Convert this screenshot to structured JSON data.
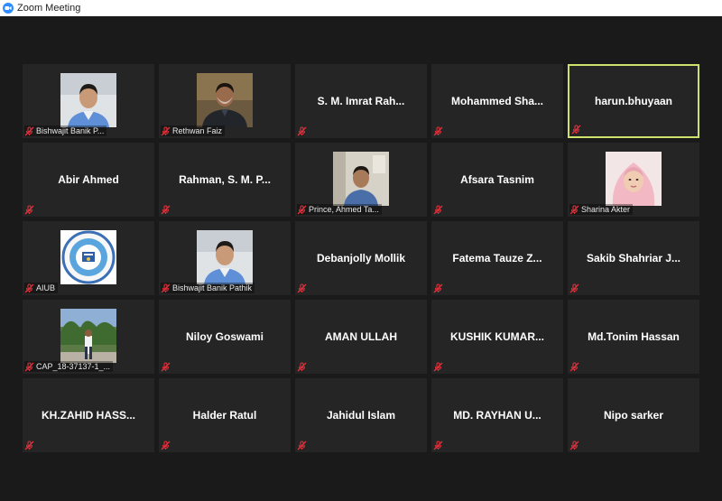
{
  "window": {
    "title": "Zoom Meeting"
  },
  "participants": [
    {
      "name": "Bishwajit Banik P...",
      "video": true,
      "photo": "man-blue-shirt"
    },
    {
      "name": "Rethwan Faiz",
      "video": true,
      "photo": "man-dark-jacket"
    },
    {
      "name": "S. M. Imrat Rah...",
      "video": false
    },
    {
      "name": "Mohammed  Sha...",
      "video": false
    },
    {
      "name": "harun.bhuyaan",
      "video": false,
      "active": true
    },
    {
      "name": "Abir Ahmed",
      "video": false
    },
    {
      "name": "Rahman, S. M. P...",
      "video": false
    },
    {
      "name": "Prince, Ahmed Ta...",
      "video": true,
      "photo": "man-room"
    },
    {
      "name": "Afsara Tasnim",
      "video": false
    },
    {
      "name": "Sharina Akter",
      "video": true,
      "photo": "woman-hijab"
    },
    {
      "name": "AIUB",
      "video": true,
      "photo": "aiub-logo"
    },
    {
      "name": "Bishwajit Banik Pathik",
      "video": true,
      "photo": "man-blue-shirt"
    },
    {
      "name": "Debanjolly Mollik",
      "video": false
    },
    {
      "name": "Fatema Tauze Z...",
      "video": false
    },
    {
      "name": "Sakib  Shahriar  J...",
      "video": false
    },
    {
      "name": "CAP_18-37137-1_...",
      "video": true,
      "photo": "man-outdoor"
    },
    {
      "name": "Niloy Goswami",
      "video": false
    },
    {
      "name": "AMAN ULLAH",
      "video": false
    },
    {
      "name": "KUSHIK  KUMAR...",
      "video": false
    },
    {
      "name": "Md.Tonim Hassan",
      "video": false
    },
    {
      "name": "KH.ZAHID  HASS...",
      "video": false
    },
    {
      "name": "Halder Ratul",
      "video": false
    },
    {
      "name": "Jahidul Islam",
      "video": false
    },
    {
      "name": "MD.  RAYHAN  U...",
      "video": false
    },
    {
      "name": "Nipo sarker",
      "video": false
    }
  ],
  "colors": {
    "background": "#1a1a1a",
    "tile": "#252525",
    "active_border": "#cfe06b",
    "muted_icon": "#e0303a"
  }
}
